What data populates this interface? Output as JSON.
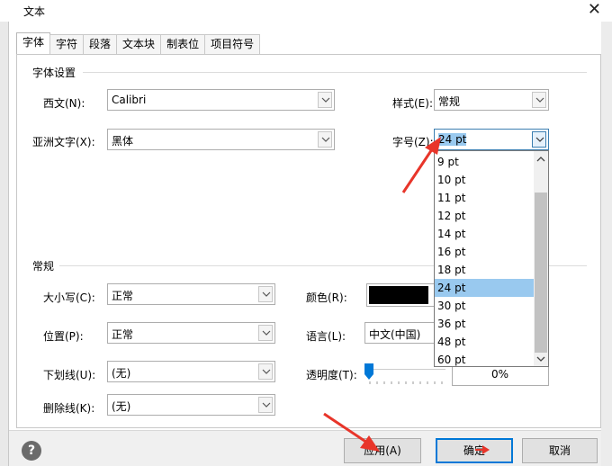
{
  "window": {
    "title": "文本",
    "close_glyph": "✕"
  },
  "tabs": [
    "字体",
    "字符",
    "段落",
    "文本块",
    "制表位",
    "项目符号"
  ],
  "font_settings": {
    "section_label": "字体设置",
    "western_label": "西文(N):",
    "western_value": "Calibri",
    "style_label": "样式(E):",
    "style_value": "常规",
    "asian_label": "亚洲文字(X):",
    "asian_value": "黑体",
    "size_label": "字号(Z):",
    "size_value": "24 pt"
  },
  "size_dropdown": {
    "options": [
      "9 pt",
      "10 pt",
      "11 pt",
      "12 pt",
      "14 pt",
      "16 pt",
      "18 pt",
      "24 pt",
      "30 pt",
      "36 pt",
      "48 pt",
      "60 pt"
    ],
    "selected": "24 pt"
  },
  "general": {
    "section_label": "常规",
    "case_label": "大小写(C):",
    "case_value": "正常",
    "position_label": "位置(P):",
    "position_value": "正常",
    "underline_label": "下划线(U):",
    "underline_value": "(无)",
    "strike_label": "删除线(K):",
    "strike_value": "(无)",
    "color_label": "颜色(R):",
    "color_value": "#000000",
    "language_label": "语言(L):",
    "language_value": "中文(中国)",
    "transparency_label": "透明度(T):",
    "transparency_value": "0%"
  },
  "buttons": {
    "help": "?",
    "apply": "应用(A)",
    "ok": "确定",
    "cancel": "取消"
  },
  "colors": {
    "annotation_arrow": "#e8352a",
    "selection": "#99c9ef",
    "focus_border": "#0078d7"
  }
}
